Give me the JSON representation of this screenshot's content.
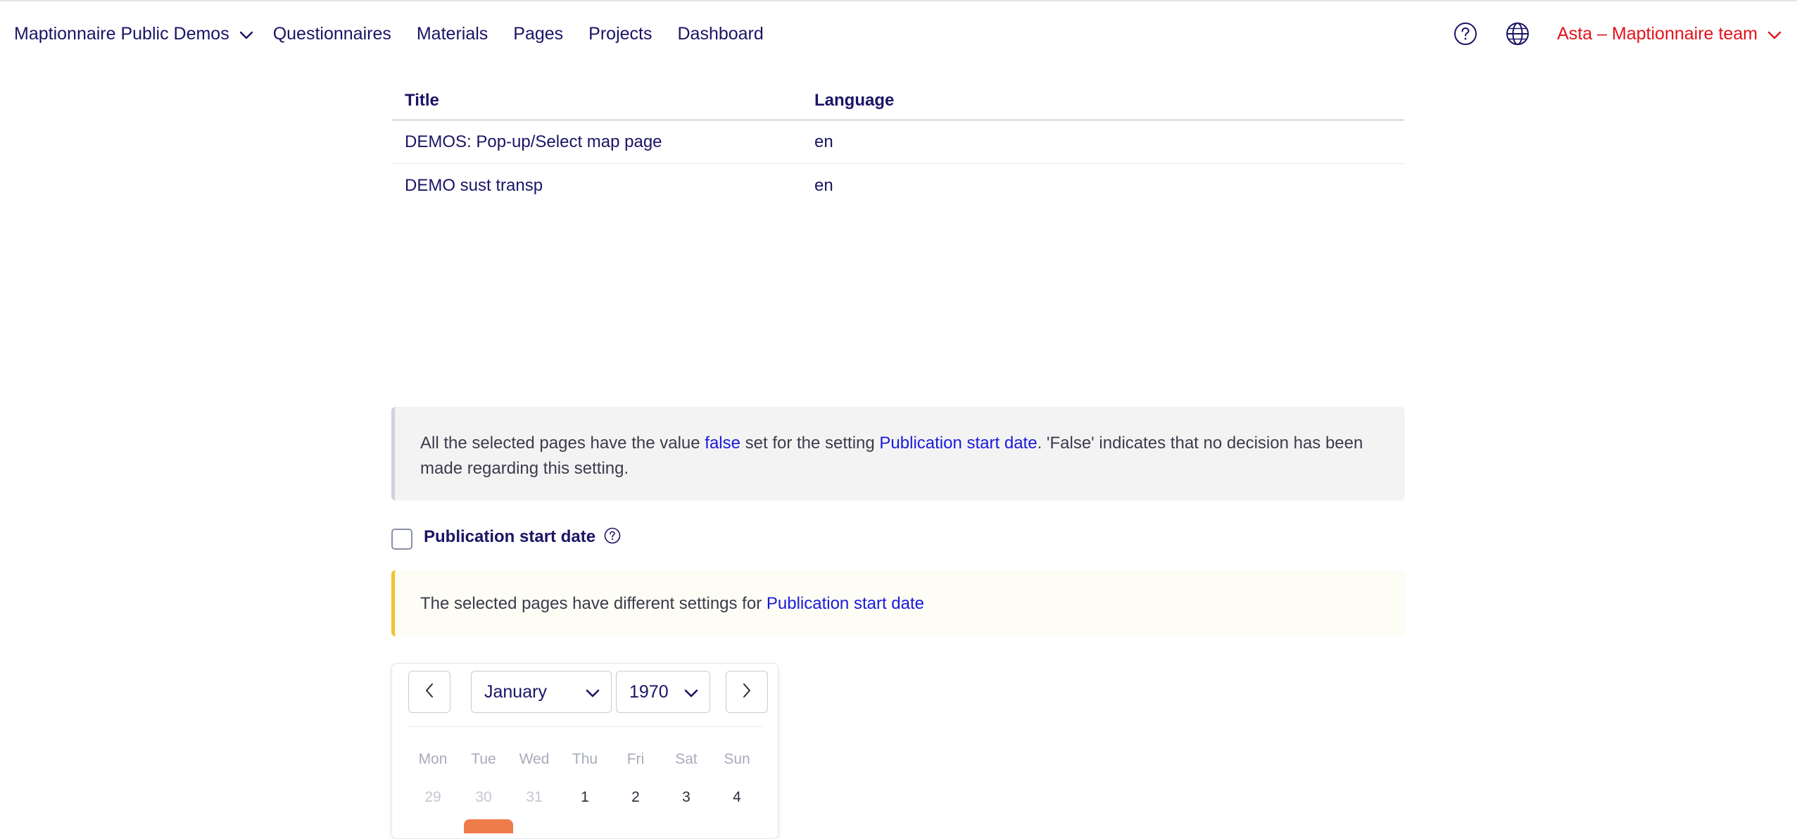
{
  "nav": {
    "org": "Maptionnaire Public Demos",
    "items": [
      "Questionnaires",
      "Materials",
      "Pages",
      "Projects",
      "Dashboard"
    ],
    "user": "Asta – Maptionnaire team"
  },
  "table": {
    "headers": {
      "title": "Title",
      "language": "Language"
    },
    "rows": [
      {
        "title": "DEMOS: Pop-up/Select map page",
        "language": "en"
      },
      {
        "title": "DEMO sust transp",
        "language": "en"
      }
    ]
  },
  "info": {
    "part1": "All the selected pages have the value ",
    "value": "false",
    "part2": " set for the setting ",
    "setting": "Publication start date",
    "part3": ". 'False' indicates that no decision has been made regarding this setting."
  },
  "setting": {
    "label": "Publication start date",
    "checked": false
  },
  "warning": {
    "text": "The selected pages have different settings for ",
    "setting": "Publication start date"
  },
  "calendar": {
    "month": "January",
    "year": "1970",
    "weekdays": [
      "Mon",
      "Tue",
      "Wed",
      "Thu",
      "Fri",
      "Sat",
      "Sun"
    ],
    "first_week": [
      "29",
      "30",
      "31",
      "1",
      "2",
      "3",
      "4"
    ],
    "muted_count": 3
  },
  "colors": {
    "primary_text": "#1b1464",
    "accent_red": "#e3131b",
    "link_blue": "#1a1adb",
    "warning_yellow": "#f2c230",
    "selected_day": "#ee7b4a"
  },
  "icons": {
    "org_chevron": "chevron-down-icon",
    "help": "help-circle-icon",
    "language": "globe-icon",
    "user_chevron": "chevron-down-icon",
    "setting_help": "help-circle-icon",
    "cal_prev": "chevron-left-icon",
    "cal_next": "chevron-right-icon"
  }
}
